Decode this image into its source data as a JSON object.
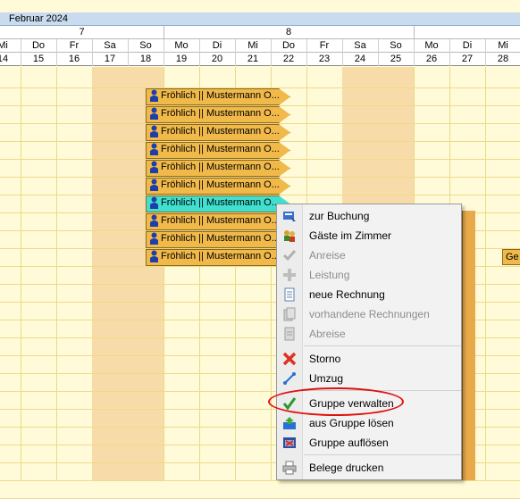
{
  "calendar": {
    "month": "Februar 2024",
    "weeks": [
      {
        "label": "7"
      },
      {
        "label": "8"
      },
      {
        "label": ""
      }
    ],
    "dows": [
      "Mi",
      "Do",
      "Fr",
      "Sa",
      "So",
      "Mo",
      "Di",
      "Mi",
      "Do",
      "Fr",
      "Sa",
      "So",
      "Mo",
      "Di",
      "Mi"
    ],
    "days": [
      "14",
      "15",
      "16",
      "17",
      "18",
      "19",
      "20",
      "21",
      "22",
      "23",
      "24",
      "25",
      "26",
      "27",
      "28"
    ]
  },
  "bookings": [
    {
      "label": "Fröhlich || Mustermann O..."
    },
    {
      "label": "Fröhlich || Mustermann O..."
    },
    {
      "label": "Fröhlich || Mustermann O..."
    },
    {
      "label": "Fröhlich || Mustermann O..."
    },
    {
      "label": "Fröhlich || Mustermann O..."
    },
    {
      "label": "Fröhlich || Mustermann O..."
    },
    {
      "label": "Fröhlich || Mustermann O...",
      "selected": true
    },
    {
      "label": "Fröhlich || Mustermann O..."
    },
    {
      "label": "Fröhlich || Mustermann O..."
    },
    {
      "label": "Fröhlich || Mustermann O..."
    }
  ],
  "side_booking": {
    "label": "Ge"
  },
  "context_menu": {
    "items": [
      {
        "label": "zur Buchung",
        "icon": "booking-icon",
        "enabled": true
      },
      {
        "label": "Gäste im Zimmer",
        "icon": "guests-icon",
        "enabled": true
      },
      {
        "label": "Anreise",
        "icon": "check-icon",
        "enabled": false
      },
      {
        "label": "Leistung",
        "icon": "plus-icon",
        "enabled": false
      },
      {
        "label": "neue Rechnung",
        "icon": "invoice-icon",
        "enabled": true
      },
      {
        "label": "vorhandene Rechnungen",
        "icon": "invoices-icon",
        "enabled": false
      },
      {
        "label": "Abreise",
        "icon": "departure-icon",
        "enabled": false
      },
      {
        "label": "Storno",
        "icon": "cancel-icon",
        "enabled": true
      },
      {
        "label": "Umzug",
        "icon": "move-icon",
        "enabled": true
      },
      {
        "label": "Gruppe verwalten",
        "icon": "group-manage-icon",
        "enabled": true,
        "highlighted": true
      },
      {
        "label": "aus Gruppe lösen",
        "icon": "group-remove-icon",
        "enabled": true
      },
      {
        "label": "Gruppe auflösen",
        "icon": "group-dissolve-icon",
        "enabled": true
      },
      {
        "label": "Belege drucken",
        "icon": "printer-icon",
        "enabled": true
      }
    ]
  },
  "colors": {
    "accent_highlight": "#e01010",
    "booking": "#f0b94a",
    "selected_booking": "#3fe0d0"
  }
}
